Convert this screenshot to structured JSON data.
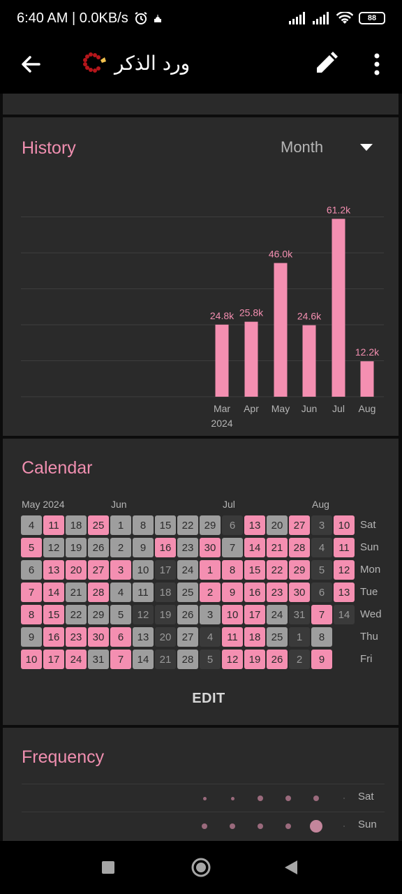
{
  "status": {
    "time": "6:40 AM",
    "speed": "0.0KB/s",
    "battery": "88"
  },
  "appbar": {
    "title": "ورد الذكر",
    "icons": [
      "back-arrow-icon",
      "prayer-beads-icon",
      "pencil-icon",
      "more-vert-icon"
    ]
  },
  "history": {
    "title": "History",
    "period": "Month",
    "chart_data": {
      "type": "bar",
      "title": "",
      "categories": [
        "Mar",
        "Apr",
        "May",
        "Jun",
        "Jul",
        "Aug"
      ],
      "year_label": "2024",
      "values": [
        24.8,
        25.8,
        46.0,
        24.6,
        61.2,
        12.2
      ],
      "value_labels": [
        "24.8k",
        "25.8k",
        "46.0k",
        "24.6k",
        "61.2k",
        "12.2k"
      ],
      "units": "thousands",
      "ylim": [
        0,
        62
      ],
      "grid": true,
      "color": "#f48fb1"
    }
  },
  "calendar": {
    "title": "Calendar",
    "month_labels": [
      "May 2024",
      "Jun",
      "Jul",
      "Aug"
    ],
    "day_labels": [
      "Sat",
      "Sun",
      "Mon",
      "Tue",
      "Wed",
      "Thu",
      "Fri"
    ],
    "edit_label": "EDIT",
    "colors": {
      "done": "#f48fb1",
      "partial": "#9e9e9e",
      "missed": "#3a3a3a"
    },
    "columns": [
      [
        [
          "4",
          "g"
        ],
        [
          "5",
          "p"
        ],
        [
          "6",
          "g"
        ],
        [
          "7",
          "p"
        ],
        [
          "8",
          "p"
        ],
        [
          "9",
          "g"
        ],
        [
          "10",
          "p"
        ]
      ],
      [
        [
          "11",
          "p"
        ],
        [
          "12",
          "g"
        ],
        [
          "13",
          "p"
        ],
        [
          "14",
          "p"
        ],
        [
          "15",
          "p"
        ],
        [
          "16",
          "p"
        ],
        [
          "17",
          "p"
        ]
      ],
      [
        [
          "18",
          "g"
        ],
        [
          "19",
          "g"
        ],
        [
          "20",
          "p"
        ],
        [
          "21",
          "g"
        ],
        [
          "22",
          "g"
        ],
        [
          "23",
          "p"
        ],
        [
          "24",
          "p"
        ]
      ],
      [
        [
          "25",
          "p"
        ],
        [
          "26",
          "g"
        ],
        [
          "27",
          "p"
        ],
        [
          "28",
          "p"
        ],
        [
          "29",
          "g"
        ],
        [
          "30",
          "p"
        ],
        [
          "31",
          "g"
        ]
      ],
      [
        [
          "1",
          "g"
        ],
        [
          "2",
          "g"
        ],
        [
          "3",
          "p"
        ],
        [
          "4",
          "g"
        ],
        [
          "5",
          "g"
        ],
        [
          "6",
          "p"
        ],
        [
          "7",
          "p"
        ]
      ],
      [
        [
          "8",
          "g"
        ],
        [
          "9",
          "g"
        ],
        [
          "10",
          "g"
        ],
        [
          "11",
          "g"
        ],
        [
          "12",
          "d"
        ],
        [
          "13",
          "g"
        ],
        [
          "14",
          "g"
        ]
      ],
      [
        [
          "15",
          "g"
        ],
        [
          "16",
          "p"
        ],
        [
          "17",
          "d"
        ],
        [
          "18",
          "d"
        ],
        [
          "19",
          "d"
        ],
        [
          "20",
          "d"
        ],
        [
          "21",
          "d"
        ]
      ],
      [
        [
          "22",
          "g"
        ],
        [
          "23",
          "g"
        ],
        [
          "24",
          "g"
        ],
        [
          "25",
          "g"
        ],
        [
          "26",
          "g"
        ],
        [
          "27",
          "g"
        ],
        [
          "28",
          "g"
        ]
      ],
      [
        [
          "29",
          "g"
        ],
        [
          "30",
          "p"
        ],
        [
          "1",
          "p"
        ],
        [
          "2",
          "p"
        ],
        [
          "3",
          "g"
        ],
        [
          "4",
          "d"
        ],
        [
          "5",
          "d"
        ]
      ],
      [
        [
          "6",
          "d"
        ],
        [
          "7",
          "g"
        ],
        [
          "8",
          "p"
        ],
        [
          "9",
          "p"
        ],
        [
          "10",
          "p"
        ],
        [
          "11",
          "p"
        ],
        [
          "12",
          "p"
        ]
      ],
      [
        [
          "13",
          "p"
        ],
        [
          "14",
          "p"
        ],
        [
          "15",
          "p"
        ],
        [
          "16",
          "p"
        ],
        [
          "17",
          "p"
        ],
        [
          "18",
          "p"
        ],
        [
          "19",
          "p"
        ]
      ],
      [
        [
          "20",
          "g"
        ],
        [
          "21",
          "p"
        ],
        [
          "22",
          "p"
        ],
        [
          "23",
          "p"
        ],
        [
          "24",
          "g"
        ],
        [
          "25",
          "g"
        ],
        [
          "26",
          "p"
        ]
      ],
      [
        [
          "27",
          "p"
        ],
        [
          "28",
          "p"
        ],
        [
          "29",
          "p"
        ],
        [
          "30",
          "p"
        ],
        [
          "31",
          "d"
        ],
        [
          "1",
          "d"
        ],
        [
          "2",
          "d"
        ]
      ],
      [
        [
          "3",
          "d"
        ],
        [
          "4",
          "d"
        ],
        [
          "5",
          "d"
        ],
        [
          "6",
          "d"
        ],
        [
          "7",
          "p"
        ],
        [
          "8",
          "g"
        ],
        [
          "9",
          "p"
        ]
      ],
      [
        [
          "10",
          "p"
        ],
        [
          "11",
          "p"
        ],
        [
          "12",
          "p"
        ],
        [
          "13",
          "p"
        ],
        [
          "14",
          "d"
        ],
        null,
        null
      ]
    ]
  },
  "frequency": {
    "title": "Frequency",
    "rows": [
      {
        "label": "Sat",
        "dots": [
          1,
          1,
          2,
          2,
          2,
          0
        ]
      },
      {
        "label": "Sun",
        "dots": [
          2,
          2,
          2,
          2,
          4,
          0
        ]
      }
    ]
  },
  "navbar": {
    "icons": [
      "recents-square-icon",
      "home-circle-icon",
      "back-triangle-icon"
    ]
  }
}
